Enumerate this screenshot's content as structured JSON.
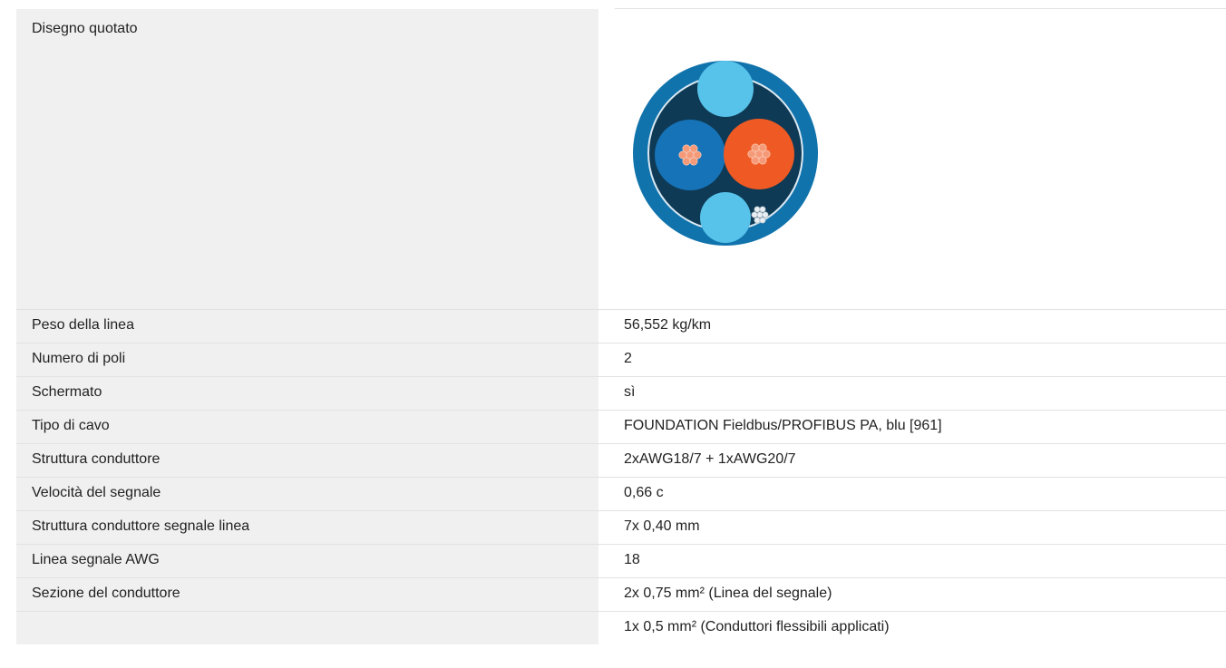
{
  "drawing": {
    "label": "Disegno quotato",
    "image_icon": "cable-cross-section-icon",
    "colors": {
      "outer_jacket": "#1173ac",
      "inner_core": "#0e3a55",
      "blue_conductor": "#1673b8",
      "orange_conductor": "#ef5a24",
      "filler": "#57c3ea",
      "copper": "#f59a78"
    }
  },
  "specs": [
    {
      "label": "Peso della linea",
      "value": "56,552 kg/km"
    },
    {
      "label": "Numero di poli",
      "value": "2"
    },
    {
      "label": "Schermato",
      "value": "sì"
    },
    {
      "label": "Tipo di cavo",
      "value": "FOUNDATION Fieldbus/PROFIBUS PA, blu [961]"
    },
    {
      "label": "Struttura conduttore",
      "value": "2xAWG18/7 + 1xAWG20/7"
    },
    {
      "label": "Velocità del segnale",
      "value": "0,66 c"
    },
    {
      "label": "Struttura conduttore segnale linea",
      "value": "7x 0,40 mm"
    },
    {
      "label": "Linea segnale AWG",
      "value": "18"
    },
    {
      "label": "Sezione del conduttore",
      "value": "2x 0,75 mm² (Linea del segnale)"
    },
    {
      "label": "",
      "value": "1x 0,5 mm² (Conduttori flessibili applicati)"
    }
  ]
}
